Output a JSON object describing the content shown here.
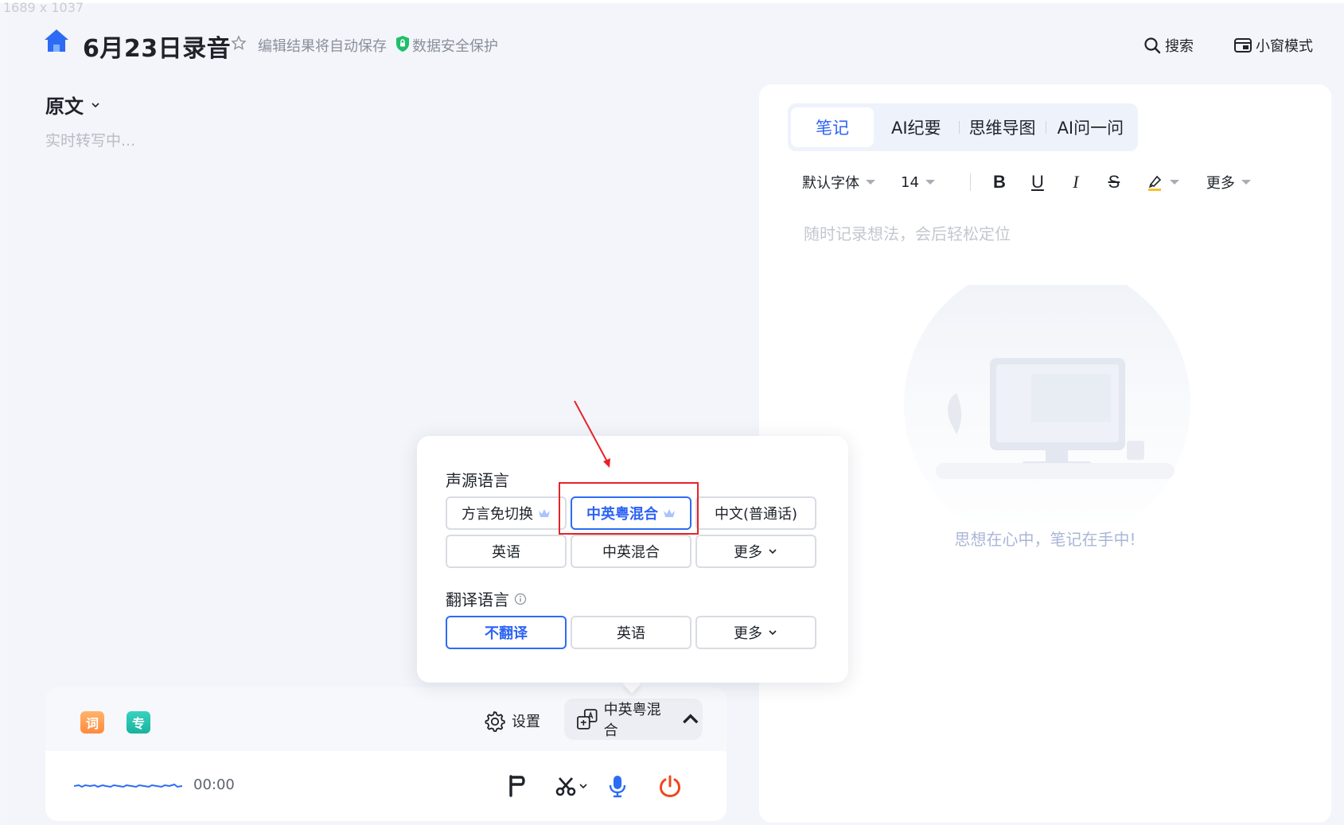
{
  "header": {
    "title": "6月23日录音",
    "autosave": "编辑结果将自动保存",
    "security": "数据安全保护",
    "search_label": "搜索",
    "mini_mode_label": "小窗模式"
  },
  "left_panel": {
    "heading": "原文",
    "status": "实时转写中..."
  },
  "notes": {
    "tabs": [
      {
        "label": "笔记",
        "active": true
      },
      {
        "label": "AI纪要",
        "active": false
      },
      {
        "label": "思维导图",
        "active": false
      },
      {
        "label": "AI问一问",
        "active": false
      }
    ],
    "toolbar": {
      "font": "默认字体",
      "size": "14",
      "bold": "B",
      "underline": "U",
      "italic": "I",
      "strike": "S",
      "more": "更多"
    },
    "placeholder": "随时记录想法，会后轻松定位",
    "empty_message": "思想在心中，笔记在手中!"
  },
  "popup": {
    "source_title": "声源语言",
    "source_options": [
      {
        "label": "方言免切换",
        "premium": true,
        "selected": false
      },
      {
        "label": "中英粤混合",
        "premium": true,
        "selected": true
      },
      {
        "label": "中文(普通话)",
        "premium": false,
        "selected": false
      },
      {
        "label": "英语",
        "premium": false,
        "selected": false
      },
      {
        "label": "中英混合",
        "premium": false,
        "selected": false
      },
      {
        "label": "更多",
        "premium": false,
        "selected": false
      }
    ],
    "translate_title": "翻译语言",
    "translate_options": [
      {
        "label": "不翻译",
        "selected": true
      },
      {
        "label": "英语",
        "selected": false
      },
      {
        "label": "更多",
        "selected": false
      }
    ]
  },
  "controls": {
    "badge_word": "词",
    "badge_pro": "专",
    "settings_label": "设置",
    "language_label": "中英粤混合",
    "timer": "00:00"
  },
  "colors": {
    "accent": "#2c63f5",
    "record_stop": "#f0461e",
    "mic": "#2c6cf5",
    "annotation_red": "#e8222a"
  }
}
